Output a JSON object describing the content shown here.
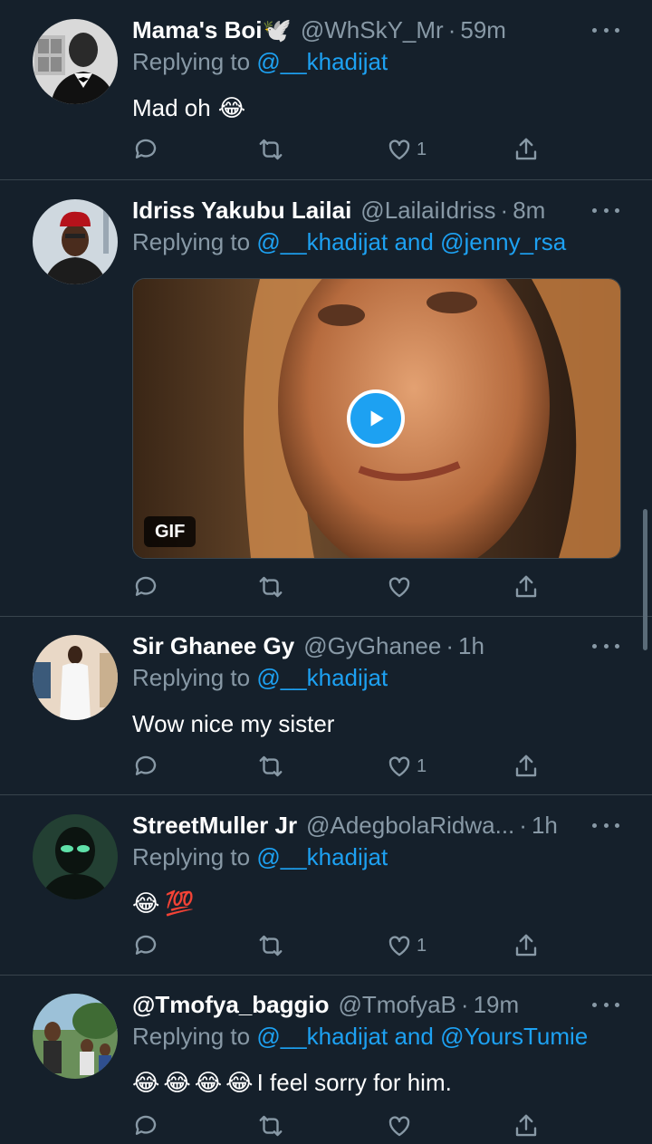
{
  "tweets": [
    {
      "name": "Mama's Boi🕊️",
      "handle": "@WhSkY_Mr",
      "time": "59m",
      "reply_prefix": "Replying to",
      "mentions": "@__khadijat",
      "text": "Mad oh",
      "emojis": [
        "😂"
      ],
      "like_count": "1"
    },
    {
      "name": "Idriss Yakubu Lailai",
      "handle": "@LailaiIdriss",
      "time": "8m",
      "reply_prefix": "Replying to",
      "mentions": "@__khadijat and @jenny_rsa",
      "media_badge": "GIF",
      "like_count": ""
    },
    {
      "name": "Sir Ghanee Gy",
      "handle": "@GyGhanee",
      "time": "1h",
      "reply_prefix": "Replying to",
      "mentions": "@__khadijat",
      "text": "Wow nice my sister",
      "like_count": "1"
    },
    {
      "name": "StreetMuller Jr",
      "handle": "@AdegbolaRidwa...",
      "time": "1h",
      "reply_prefix": "Replying to",
      "mentions": "@__khadijat",
      "emojis": [
        "😂",
        "💯"
      ],
      "like_count": "1"
    },
    {
      "name": "@Tmofya_baggio",
      "handle": "@TmofyaB",
      "time": "19m",
      "reply_prefix": "Replying to",
      "mentions": "@__khadijat and @YoursTumie",
      "emojis": [
        "😂",
        "😂",
        "😂",
        "😂"
      ],
      "text": "I feel sorry for him."
    }
  ],
  "separator": "·",
  "colors": {
    "background": "#15202b",
    "secondary_text": "#8899a6",
    "link": "#1da1f2",
    "divider": "#38444d"
  },
  "icons": [
    "reply-icon",
    "retweet-icon",
    "like-icon",
    "share-icon",
    "more-icon",
    "play-icon"
  ]
}
